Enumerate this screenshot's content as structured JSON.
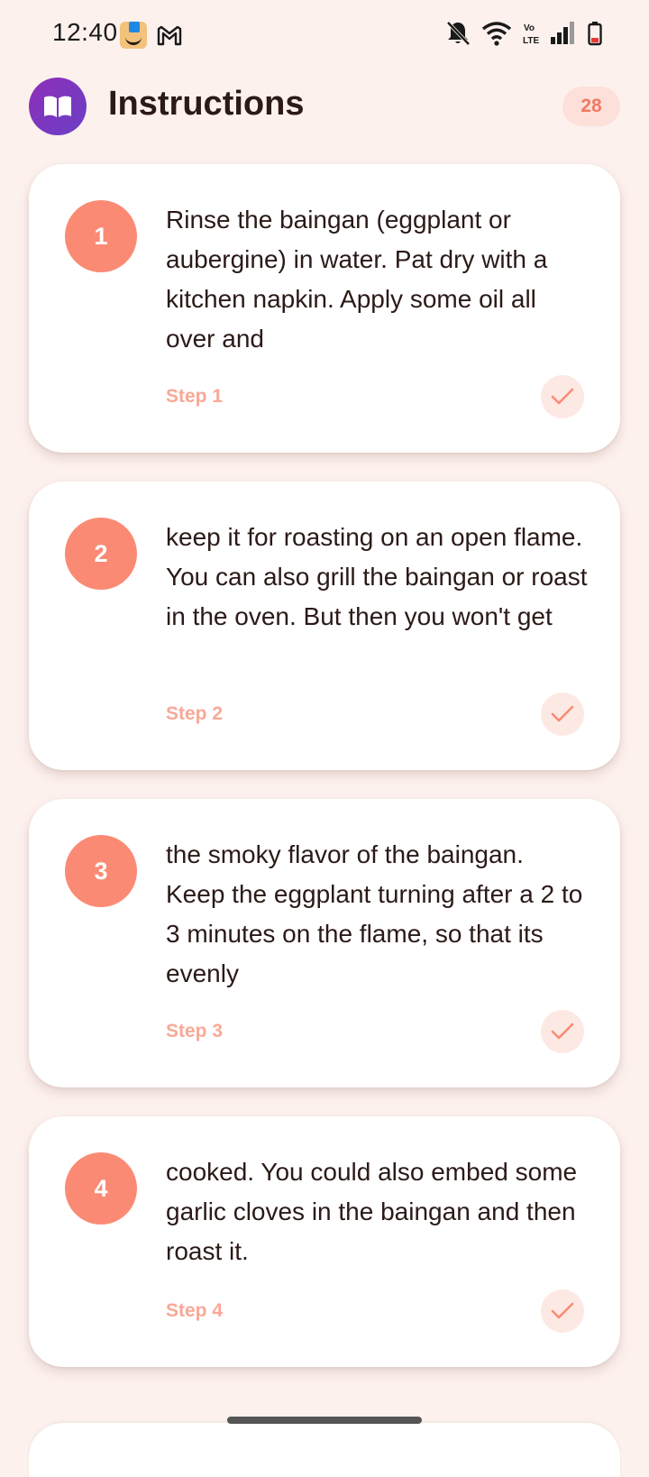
{
  "status_bar": {
    "time": "12:40",
    "left_icons": [
      "amazon-app-icon",
      "gmail-icon"
    ],
    "right_icons": [
      "bell-off-icon",
      "wifi-icon",
      "volte-icon",
      "signal-icon",
      "battery-low-icon"
    ],
    "volte_label": "Vo LTE"
  },
  "header": {
    "title": "Instructions",
    "logo_icon": "open-book-icon",
    "count": "28"
  },
  "colors": {
    "background": "#fdf1ee",
    "accent": "#fb8a74",
    "logo_purple": "#7b35c0",
    "step_label": "#f9a897"
  },
  "steps": [
    {
      "number": "1",
      "text": "Rinse the baingan (eggplant or aubergine) in water. Pat dry with a kitchen napkin. Apply some oil all over and",
      "label": "Step 1",
      "check_icon": "check-icon"
    },
    {
      "number": "2",
      "text": "keep it for roasting on an open flame. You can also grill the baingan or roast in the oven. But then you won't get",
      "label": "Step 2",
      "check_icon": "check-icon"
    },
    {
      "number": "3",
      "text": "the smoky flavor of the baingan. Keep the eggplant turning after a 2 to 3 minutes on the flame, so that its evenly",
      "label": "Step 3",
      "check_icon": "check-icon"
    },
    {
      "number": "4",
      "text": "cooked. You could also embed some garlic cloves in the baingan and then roast it.",
      "label": "Step 4",
      "check_icon": "check-icon"
    }
  ]
}
